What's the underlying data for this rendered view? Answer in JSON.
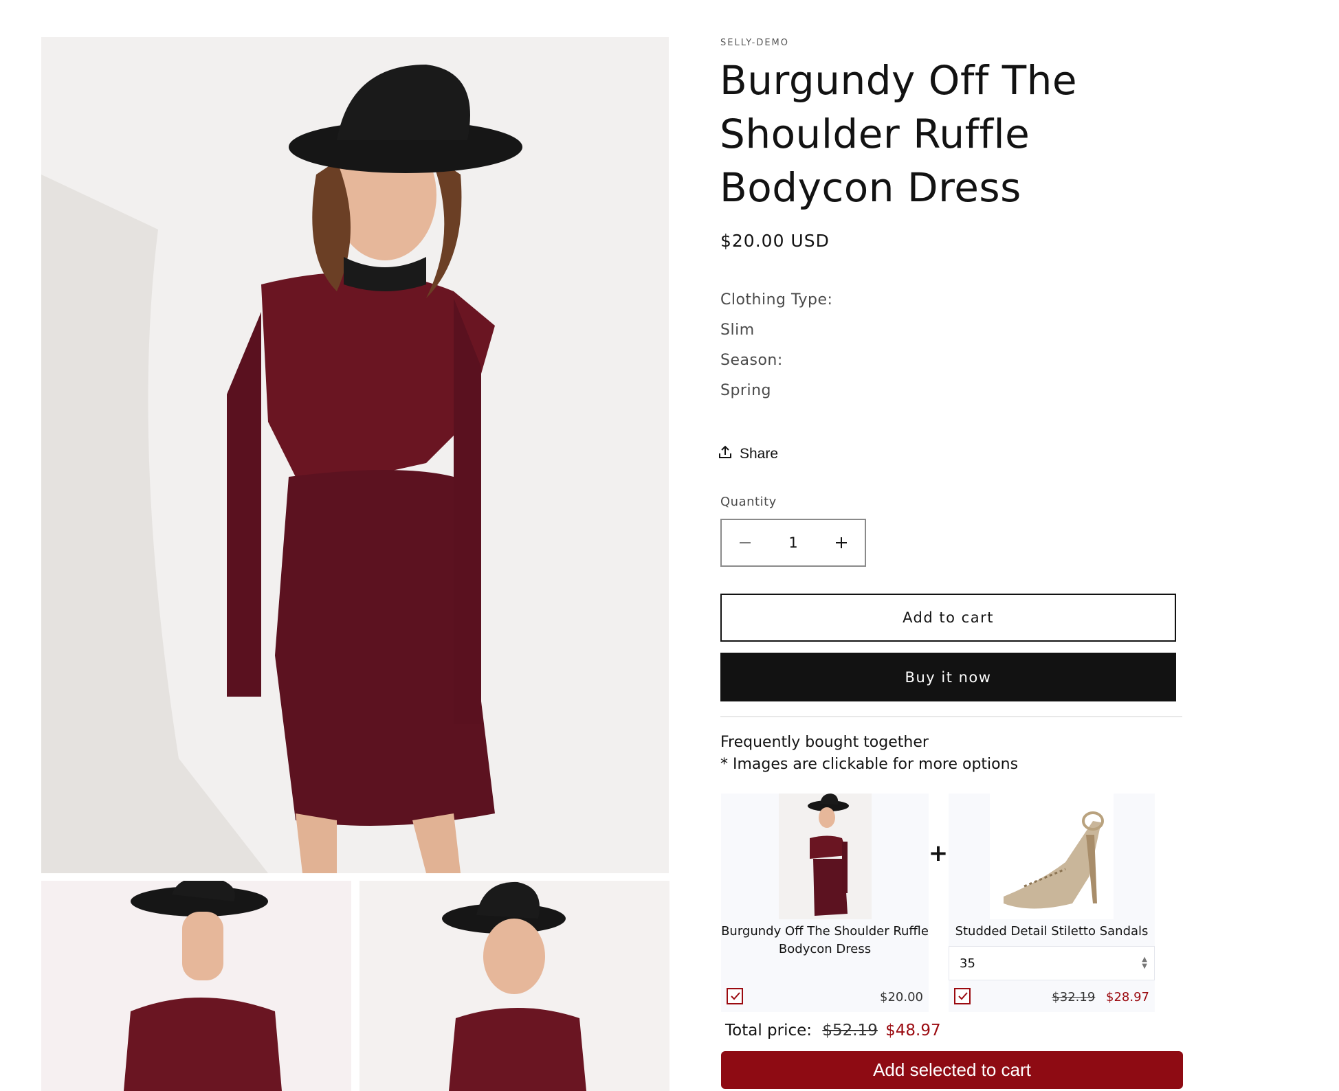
{
  "product": {
    "vendor": "SELLY-DEMO",
    "title": "Burgundy Off The Shoulder Ruffle Bodycon Dress",
    "price": "$20.00 USD",
    "description": [
      "Clothing Type:",
      "Slim",
      "Season:",
      "Spring"
    ]
  },
  "share": {
    "label": "Share",
    "icon": "share-icon"
  },
  "quantity": {
    "label": "Quantity",
    "value": "1",
    "decrement_icon": "minus-icon",
    "increment_icon": "plus-icon"
  },
  "buttons": {
    "add_to_cart": "Add to cart",
    "buy_now": "Buy it now"
  },
  "bundle": {
    "title": "Frequently bought together",
    "note": "* Images are clickable for more options",
    "items": [
      {
        "name": "Burgundy Off The Shoulder Ruffle Bodycon Dress",
        "price": "$20.00",
        "checked": true
      },
      {
        "name": "Studded Detail Stiletto Sandals",
        "variant": "35",
        "old_price": "$32.19",
        "price": "$28.97",
        "checked": true
      }
    ],
    "plus": "+",
    "total_label": "Total price:",
    "total_old": "$52.19",
    "total_new": "$48.97",
    "button": "Add selected to cart"
  },
  "colors": {
    "accent": "#8e0b13",
    "primary": "#121212"
  }
}
